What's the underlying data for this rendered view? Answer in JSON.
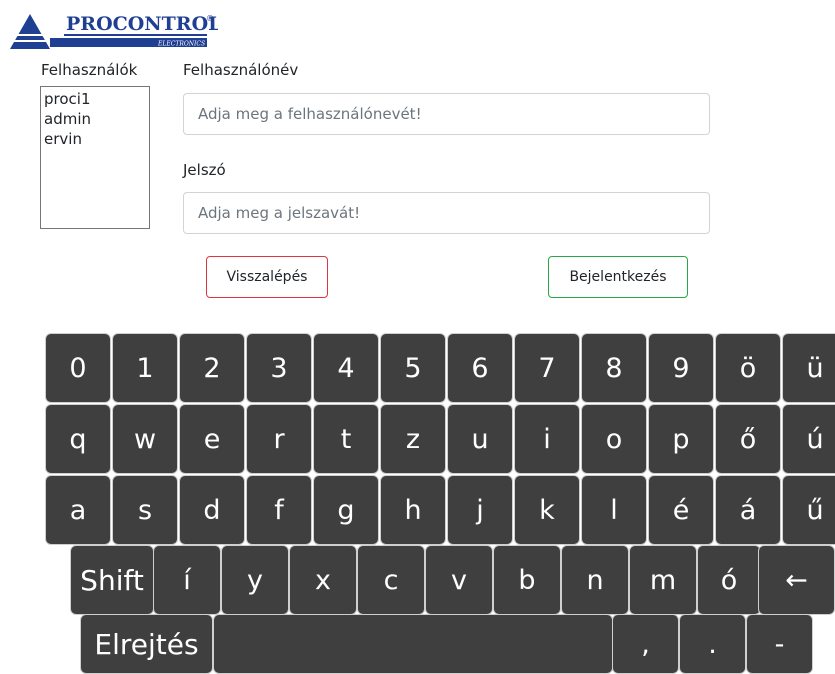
{
  "logo": {
    "text": "PROCONTROL",
    "sub": "ELECTRONICS",
    "mark": "®",
    "color": "#1f3f92"
  },
  "users_label": "Felhasználók",
  "users": [
    "proci1",
    "admin",
    "ervin"
  ],
  "username": {
    "label": "Felhasználónév",
    "placeholder": "Adja meg a felhasználónevét!",
    "value": ""
  },
  "password": {
    "label": "Jelszó",
    "placeholder": "Adja meg a jelszavát!",
    "value": ""
  },
  "buttons": {
    "back": "Visszalépés",
    "login": "Bejelentkezés"
  },
  "colors": {
    "back_border": "#dc3545",
    "login_border": "#28a745",
    "key_bg": "#3f3f3f"
  },
  "keyboard": {
    "row1": [
      "0",
      "1",
      "2",
      "3",
      "4",
      "5",
      "6",
      "7",
      "8",
      "9",
      "ö",
      "ü"
    ],
    "row2": [
      "q",
      "w",
      "e",
      "r",
      "t",
      "z",
      "u",
      "i",
      "o",
      "p",
      "ő",
      "ú"
    ],
    "row3": [
      "a",
      "s",
      "d",
      "f",
      "g",
      "h",
      "j",
      "k",
      "l",
      "é",
      "á",
      "ű"
    ],
    "row4": [
      "Shift",
      "í",
      "y",
      "x",
      "c",
      "v",
      "b",
      "n",
      "m",
      "ó",
      "←"
    ],
    "row5": [
      "Elrejtés",
      "",
      ",",
      ".",
      "-"
    ]
  }
}
